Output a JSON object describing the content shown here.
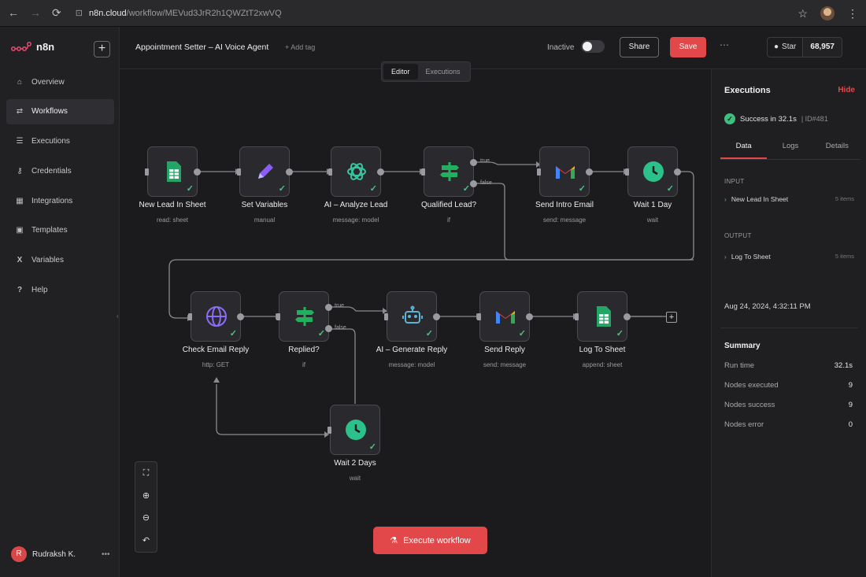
{
  "browser": {
    "url_host": "n8n.cloud",
    "url_path": "/workflow/MEVud3JrR2h1QWZtT2xwVQ"
  },
  "sidebar": {
    "brand": "n8n",
    "items": [
      {
        "label": "Overview",
        "icon": "home-icon"
      },
      {
        "label": "Workflows",
        "icon": "workflows-icon",
        "active": true
      },
      {
        "label": "Executions",
        "icon": "list-icon"
      },
      {
        "label": "Credentials",
        "icon": "key-icon"
      },
      {
        "label": "Integrations",
        "icon": "grid-icon"
      },
      {
        "label": "Templates",
        "icon": "book-icon"
      },
      {
        "label": "Variables",
        "icon": "variable-icon"
      },
      {
        "label": "Help",
        "icon": "help-icon"
      }
    ],
    "user": {
      "initial": "R",
      "name": "Rudraksh K."
    }
  },
  "header": {
    "title": "Appointment Setter – AI Voice Agent",
    "add_tag": "+ Add tag",
    "status": "Inactive",
    "share": "Share",
    "save": "Save",
    "star": "Star",
    "star_count": "68,957"
  },
  "tabs": {
    "editor": "Editor",
    "executions": "Executions"
  },
  "nodes": [
    {
      "name": "New Lead In Sheet",
      "sub": "read: sheet",
      "icon": "google-sheets-icon"
    },
    {
      "name": "Set Variables",
      "sub": "manual",
      "icon": "pencil-icon"
    },
    {
      "name": "AI – Analyze Lead",
      "sub": "message: model",
      "icon": "openai-icon"
    },
    {
      "name": "Qualified Lead?",
      "sub": "if",
      "icon": "if-signpost-icon"
    },
    {
      "name": "Send Intro Email",
      "sub": "send: message",
      "icon": "gmail-icon"
    },
    {
      "name": "Wait 1 Day",
      "sub": "wait",
      "icon": "clock-icon"
    },
    {
      "name": "Check Email Reply",
      "sub": "http: GET",
      "icon": "globe-icon"
    },
    {
      "name": "Replied?",
      "sub": "if",
      "icon": "if-signpost-icon"
    },
    {
      "name": "AI – Generate Reply",
      "sub": "message: model",
      "icon": "robot-icon"
    },
    {
      "name": "Send Reply",
      "sub": "send: message",
      "icon": "gmail-icon"
    },
    {
      "name": "Log To Sheet",
      "sub": "append: sheet",
      "icon": "google-sheets-icon"
    },
    {
      "name": "Wait 2 Days",
      "sub": "wait",
      "icon": "clock-icon"
    }
  ],
  "branches": {
    "true": "true",
    "false": "false"
  },
  "execute_button": "Execute workflow",
  "panel": {
    "title": "Executions",
    "hide": "Hide",
    "status": "Success in 32.1s",
    "id": "ID#481",
    "tabs": [
      "Data",
      "Logs",
      "Details"
    ],
    "input_label": "INPUT",
    "input_item": "New Lead In Sheet",
    "input_count": "5 items",
    "output_label": "OUTPUT",
    "output_item": "Log To Sheet",
    "output_count": "5 items",
    "date": "Aug 24, 2024, 4:32:11 PM",
    "summary_title": "Summary",
    "summary": [
      {
        "k": "Run time",
        "v": "32.1s"
      },
      {
        "k": "Nodes executed",
        "v": "9"
      },
      {
        "k": "Nodes success",
        "v": "9"
      },
      {
        "k": "Nodes error",
        "v": "0"
      }
    ]
  },
  "colors": {
    "accent": "#e2474a",
    "success": "#4cc383"
  }
}
